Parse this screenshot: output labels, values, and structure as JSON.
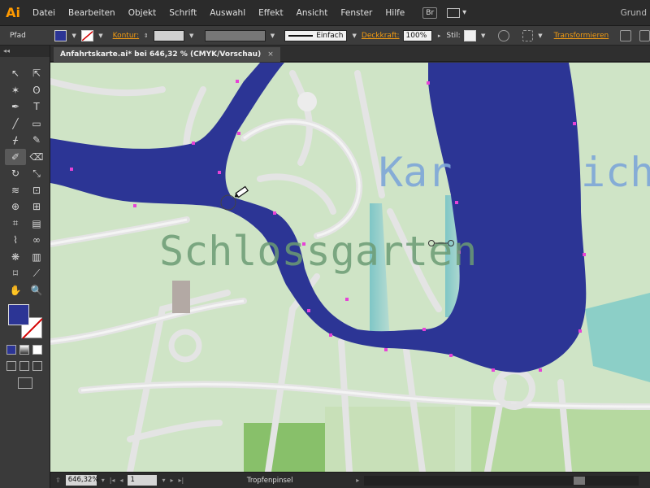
{
  "app": {
    "logo": "Ai",
    "workspace": "Grund"
  },
  "menu": [
    "Datei",
    "Bearbeiten",
    "Objekt",
    "Schrift",
    "Auswahl",
    "Effekt",
    "Ansicht",
    "Fenster",
    "Hilfe"
  ],
  "menu_extras": {
    "bridge": "Br"
  },
  "controlbar": {
    "selection": "Pfad",
    "fill_color": "#2c3595",
    "stroke_label": "Kontur:",
    "stroke_style": "Einfach",
    "opacity_label": "Deckkraft:",
    "opacity_value": "100%",
    "style_label": "Stil:",
    "transform_label": "Transformieren"
  },
  "document": {
    "tab_title": "Anfahrtskarte.ai* bei 646,32 % (CMYK/Vorschau)",
    "close": "×"
  },
  "toolbox": {
    "grip": "◂◂",
    "tools": [
      {
        "name": "selection-tool-icon",
        "glyph": "↖"
      },
      {
        "name": "direct-selection-tool-icon",
        "glyph": "⇱"
      },
      {
        "name": "magic-wand-tool-icon",
        "glyph": "✶"
      },
      {
        "name": "lasso-tool-icon",
        "glyph": "ʘ"
      },
      {
        "name": "pen-tool-icon",
        "glyph": "✒"
      },
      {
        "name": "type-tool-icon",
        "glyph": "T"
      },
      {
        "name": "line-tool-icon",
        "glyph": "╱"
      },
      {
        "name": "rectangle-tool-icon",
        "glyph": "▭"
      },
      {
        "name": "paintbrush-tool-icon",
        "glyph": "ᚋ"
      },
      {
        "name": "pencil-tool-icon",
        "glyph": "✎"
      },
      {
        "name": "blob-brush-tool-icon",
        "glyph": "✐"
      },
      {
        "name": "eraser-tool-icon",
        "glyph": "⌫"
      },
      {
        "name": "rotate-tool-icon",
        "glyph": "↻"
      },
      {
        "name": "scale-tool-icon",
        "glyph": "⤡"
      },
      {
        "name": "warp-tool-icon",
        "glyph": "≋"
      },
      {
        "name": "free-transform-tool-icon",
        "glyph": "⊡"
      },
      {
        "name": "shape-builder-tool-icon",
        "glyph": "⊕"
      },
      {
        "name": "perspective-grid-tool-icon",
        "glyph": "⊞"
      },
      {
        "name": "mesh-tool-icon",
        "glyph": "⌗"
      },
      {
        "name": "gradient-tool-icon",
        "glyph": "▤"
      },
      {
        "name": "eyedropper-tool-icon",
        "glyph": "⌇"
      },
      {
        "name": "blend-tool-icon",
        "glyph": "∞"
      },
      {
        "name": "symbol-sprayer-tool-icon",
        "glyph": "❋"
      },
      {
        "name": "column-graph-tool-icon",
        "glyph": "▥"
      },
      {
        "name": "artboard-tool-icon",
        "glyph": "⌑"
      },
      {
        "name": "slice-tool-icon",
        "glyph": "⟋"
      },
      {
        "name": "hand-tool-icon",
        "glyph": "✋"
      },
      {
        "name": "zoom-tool-icon",
        "glyph": "🔍"
      }
    ]
  },
  "map_labels": {
    "park": "Schlossgarten",
    "area": "Karlsruhe-Durlach"
  },
  "map_visible_text": {
    "park": "Schlossgarten",
    "area_left": "Kar",
    "area_right": "ich"
  },
  "statusbar": {
    "zoom": "646,32%",
    "artboard": "1",
    "tool": "Tropfenpinsel"
  }
}
